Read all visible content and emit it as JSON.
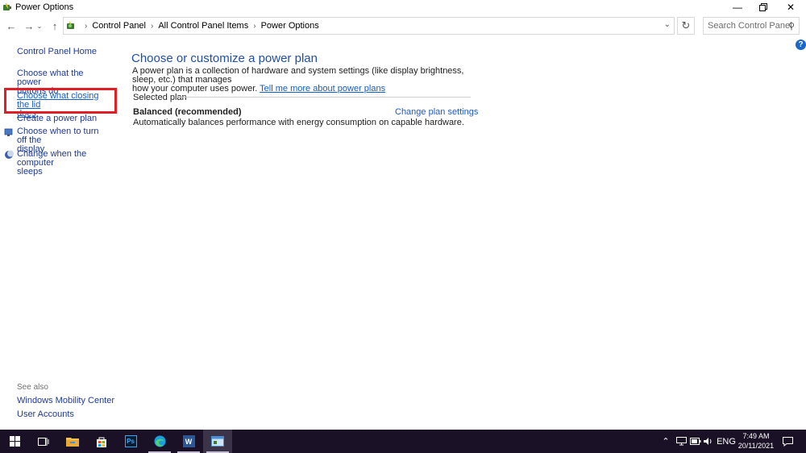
{
  "window": {
    "title": "Power Options"
  },
  "address": {
    "crumbs": [
      "Control Panel",
      "All Control Panel Items",
      "Power Options"
    ]
  },
  "search": {
    "placeholder": "Search Control Panel"
  },
  "help_label": "?",
  "leftnav": {
    "home": "Control Panel Home",
    "items": [
      {
        "line1": "Choose what the power",
        "line2": "buttons do"
      },
      {
        "line1": "Choose what closing the lid",
        "line2": "does"
      },
      {
        "line1": "Create a power plan"
      },
      {
        "line1": "Choose when to turn off the",
        "line2": "display"
      },
      {
        "line1": "Change when the computer",
        "line2": "sleeps"
      }
    ],
    "see_also": "See also",
    "see_also_links": [
      "Windows Mobility Center",
      "User Accounts"
    ]
  },
  "main": {
    "title": "Choose or customize a power plan",
    "desc_line1": "A power plan is a collection of hardware and system settings (like display brightness, sleep, etc.) that manages",
    "desc_line2": "how your computer uses power.",
    "desc_link": "Tell me more about power plans",
    "selected_plan_label": "Selected plan",
    "plan_name": "Balanced (recommended)",
    "plan_link": "Change plan settings",
    "plan_desc": "Automatically balances performance with energy consumption on capable hardware."
  },
  "taskbar": {
    "language": "ENG",
    "time": "7:49 AM",
    "date": "20/11/2021",
    "ps_label": "Ps",
    "word_label": "W"
  },
  "colors": {
    "link": "#1f3a93",
    "title": "#1e4fa8",
    "highlight": "#e01e26",
    "taskbar": "#1a1126"
  }
}
